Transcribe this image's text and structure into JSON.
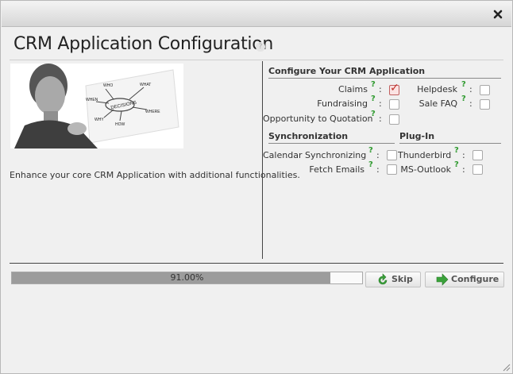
{
  "dialog": {
    "title": "CRM Application Configuration",
    "help_icon": "question-circle-icon",
    "close_icon": "close-icon"
  },
  "left_panel": {
    "image_caption_words": [
      "WHO",
      "WHAT",
      "WHEN",
      "DECISIONS",
      "WHY",
      "WHERE",
      "HOW"
    ],
    "description": "Enhance your core CRM Application with additional functionalities."
  },
  "configure": {
    "heading": "Configure Your CRM Application",
    "options": [
      {
        "label": "Claims",
        "checked": true
      },
      {
        "label": "Helpdesk",
        "checked": false
      },
      {
        "label": "Fundraising",
        "checked": false
      },
      {
        "label": "Sale FAQ",
        "checked": false
      },
      {
        "label": "Opportunity to Quotation",
        "checked": false
      }
    ]
  },
  "synchronization": {
    "heading": "Synchronization",
    "options": [
      {
        "label": "Calendar Synchronizing",
        "checked": false
      },
      {
        "label": "Fetch Emails",
        "checked": false
      }
    ]
  },
  "plugin": {
    "heading": "Plug-In",
    "options": [
      {
        "label": "Thunderbird",
        "checked": false
      },
      {
        "label": "MS-Outlook",
        "checked": false
      }
    ]
  },
  "help_marker": "?",
  "colon": ":",
  "progress": {
    "value": 0.91,
    "text": "91.00%"
  },
  "buttons": {
    "skip_label": "Skip",
    "configure_label": "Configure"
  },
  "colors": {
    "check_accent": "#c0302a",
    "help_green": "#2f9a2f",
    "button_icon_green": "#3aa23a"
  }
}
